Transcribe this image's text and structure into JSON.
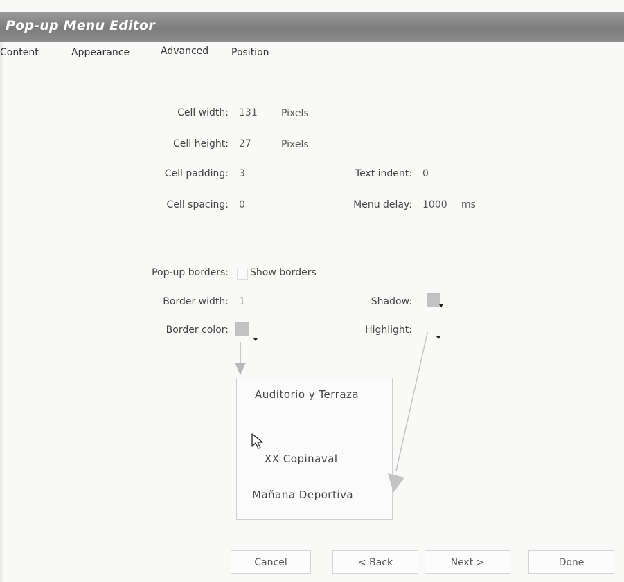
{
  "window": {
    "title": "Pop-up Menu Editor"
  },
  "tabs": [
    "Content",
    "Appearance",
    "Advanced",
    "Position"
  ],
  "fields": {
    "cell_width": {
      "label": "Cell width:",
      "value": "131",
      "unit": "Pixels"
    },
    "cell_height": {
      "label": "Cell height:",
      "value": "27",
      "unit": "Pixels"
    },
    "cell_padding": {
      "label": "Cell padding:",
      "value": "3"
    },
    "cell_spacing": {
      "label": "Cell spacing:",
      "value": "0"
    },
    "text_indent": {
      "label": "Text indent:",
      "value": "0"
    },
    "menu_delay": {
      "label": "Menu delay:",
      "value": "1000",
      "unit": "ms"
    },
    "popup_borders": {
      "label": "Pop-up borders:",
      "checkbox_label": "Show borders"
    },
    "border_width": {
      "label": "Border width:",
      "value": "1"
    },
    "border_color": {
      "label": "Border color:",
      "color": "#c2c2c2"
    },
    "shadow": {
      "label": "Shadow:",
      "color": "#c2c2c2"
    },
    "highlight": {
      "label": "Highlight:"
    }
  },
  "preview": {
    "items": [
      "Auditorio y Terraza",
      "XX Copinaval",
      "Mañana Deportiva"
    ]
  },
  "buttons": {
    "cancel": "Cancel",
    "back": "< Back",
    "next": "Next >",
    "done": "Done"
  },
  "colors": {
    "titlebar": "#888888",
    "arrow": "#b8b8b8"
  }
}
